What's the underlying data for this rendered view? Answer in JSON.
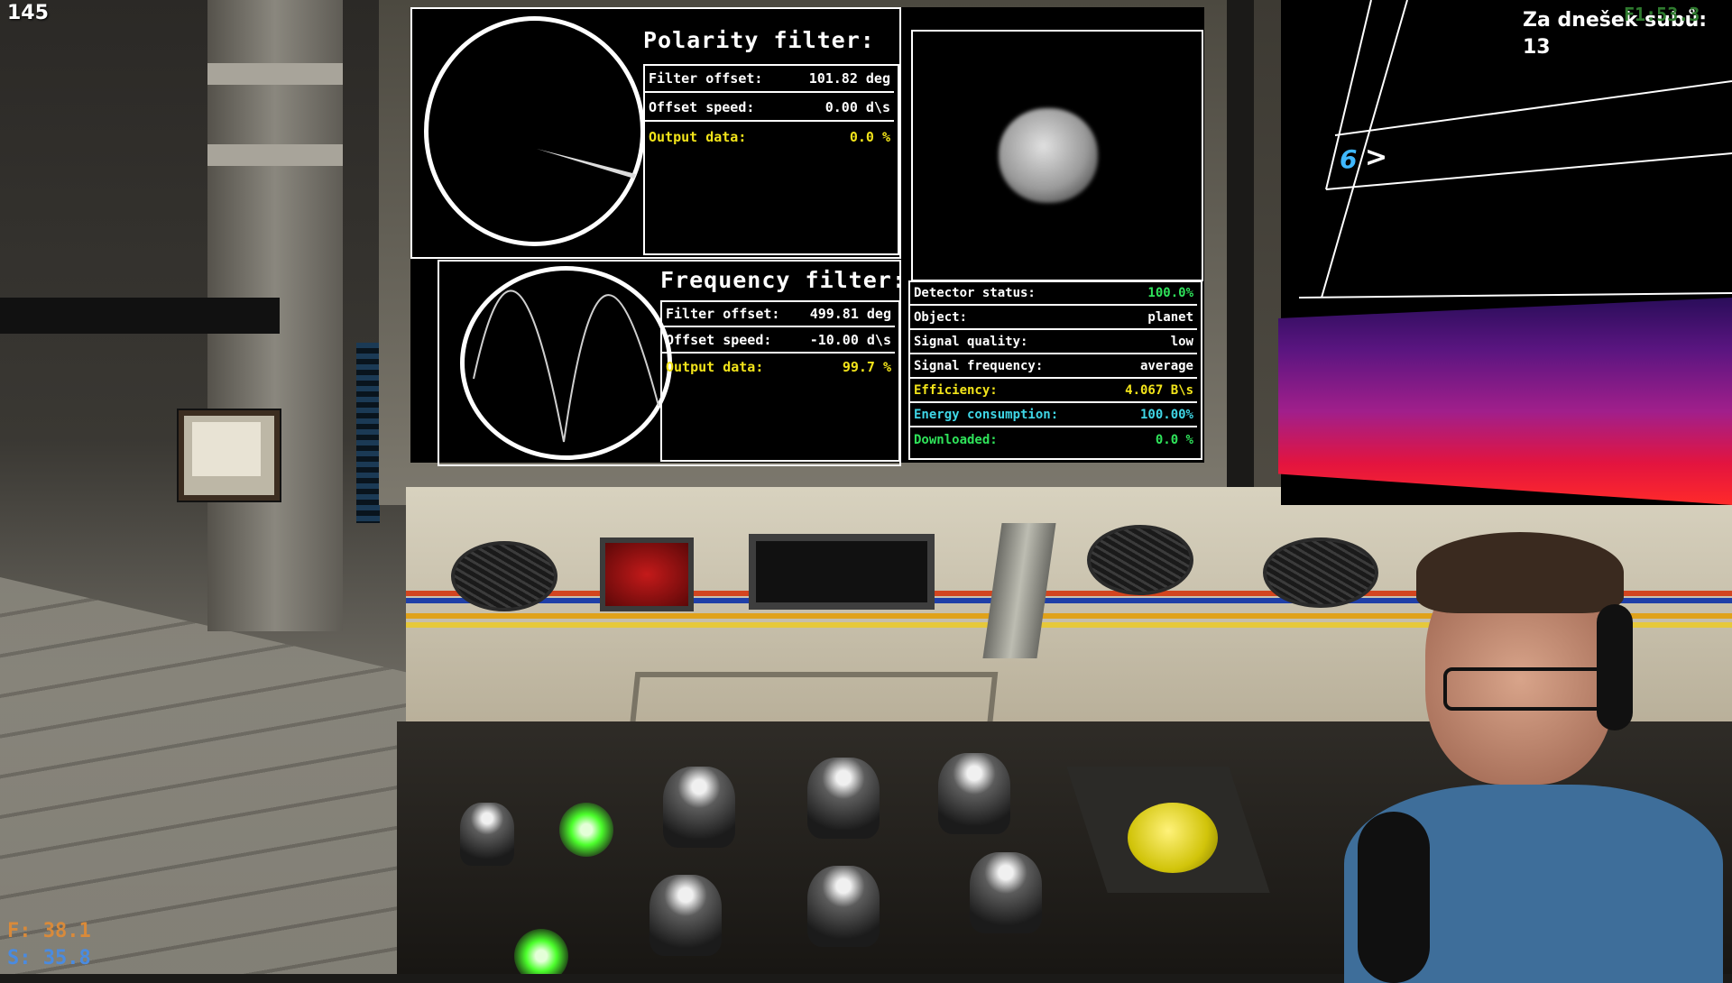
{
  "hud": {
    "fps_counter": "145",
    "subs_label": "Za dnešek subů:",
    "subs_count": "13",
    "corner_readout": "F1:53.3",
    "f_stat": "F: 38.1",
    "s_stat": "S: 35.8"
  },
  "polarity": {
    "title": "Polarity filter:",
    "rows": [
      {
        "label": "Filter offset:",
        "value": "101.82 deg"
      },
      {
        "label": "Offset speed:",
        "value": "0.00 d\\s"
      },
      {
        "label": "Output data:",
        "value": "0.0 %"
      }
    ]
  },
  "frequency": {
    "title": "Frequency filter:",
    "rows": [
      {
        "label": "Filter offset:",
        "value": "499.81 deg"
      },
      {
        "label": "Offset speed:",
        "value": "-10.00 d\\s"
      },
      {
        "label": "Output data:",
        "value": "99.7 %"
      }
    ]
  },
  "detector": {
    "rows": [
      {
        "label": "Detector status:",
        "value": "100.0%"
      },
      {
        "label": "Object:",
        "value": "planet"
      },
      {
        "label": "Signal quality:",
        "value": "low"
      },
      {
        "label": "Signal frequency:",
        "value": "average"
      },
      {
        "label": "Efficiency:",
        "value": "4.067 B\\s"
      },
      {
        "label": "Energy consumption:",
        "value": "100.00%"
      },
      {
        "label": "Downloaded:",
        "value": "0.0 %"
      }
    ]
  },
  "right_screen": {
    "channel": "6",
    "arrow": ">"
  },
  "colors": {
    "screen_text": "#ffffff",
    "highlight_yellow": "#f2e41a",
    "status_green": "#2fe35a",
    "energy_cyan": "#3fd6e6",
    "channel_blue": "#3fb8ff",
    "stat_f_orange": "#d98a3a",
    "stat_s_blue": "#4a8be0"
  }
}
